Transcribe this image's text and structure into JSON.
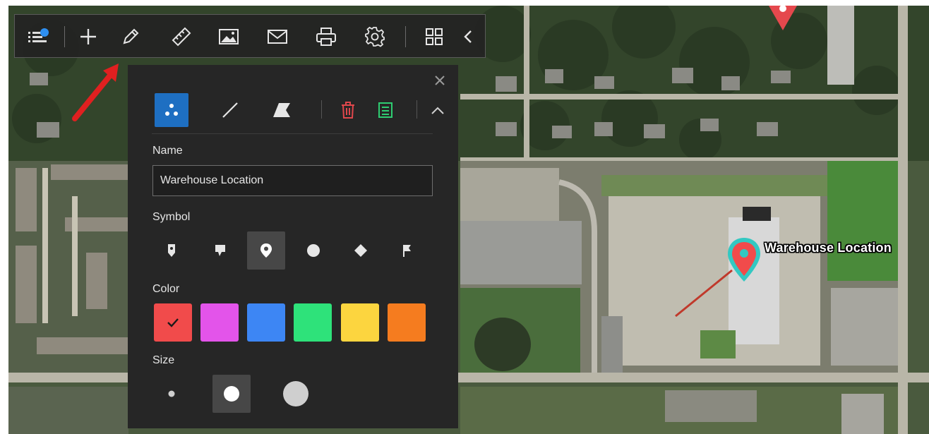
{
  "toolbar": {
    "buttons": [
      {
        "name": "layers-list-button",
        "icon": "layers-list-icon"
      },
      {
        "name": "add-button",
        "icon": "plus-icon"
      },
      {
        "name": "draw-button",
        "icon": "pencil-icon"
      },
      {
        "name": "measure-button",
        "icon": "ruler-icon"
      },
      {
        "name": "image-button",
        "icon": "image-icon"
      },
      {
        "name": "email-button",
        "icon": "envelope-icon"
      },
      {
        "name": "print-button",
        "icon": "printer-icon"
      },
      {
        "name": "settings-button",
        "icon": "gear-icon"
      },
      {
        "name": "grid-button",
        "icon": "grid-icon"
      },
      {
        "name": "collapse-button",
        "icon": "chevron-left-icon"
      }
    ]
  },
  "draw_panel": {
    "modes": [
      "point",
      "line",
      "polygon"
    ],
    "active_mode": "point",
    "name_label": "Name",
    "name_value": "Warehouse Location",
    "symbol_label": "Symbol",
    "symbols": [
      "pin-icon",
      "callout-icon",
      "map-marker-icon",
      "circle-icon",
      "diamond-icon",
      "flag-icon"
    ],
    "active_symbol": "map-marker-icon",
    "color_label": "Color",
    "colors": [
      "#f14b4b",
      "#e354ea",
      "#3d86f4",
      "#2ee27a",
      "#fcd53f",
      "#f57c1f"
    ],
    "active_color": "#f14b4b",
    "size_label": "Size",
    "sizes": [
      "small",
      "medium",
      "large"
    ],
    "active_size": "medium",
    "delete_color": "#e0474c",
    "save_color": "#2ecc71",
    "accent": "#1e6fc2"
  },
  "map": {
    "marker_label": "Warehouse Location",
    "marker_color": "#f14b4b"
  }
}
